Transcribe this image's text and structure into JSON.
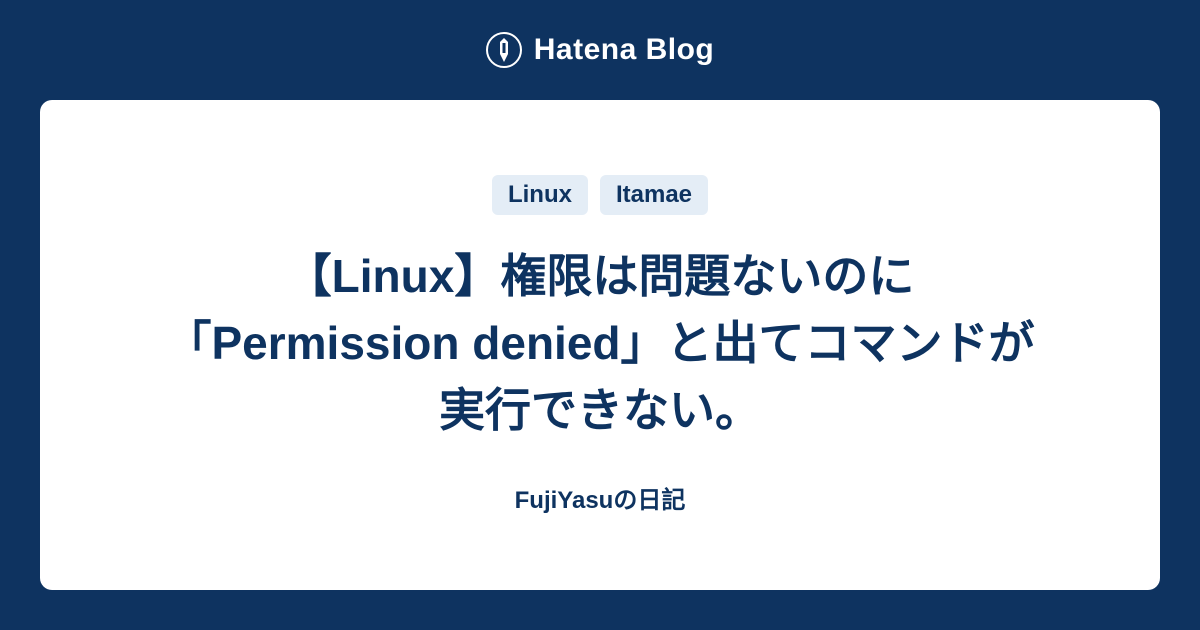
{
  "header": {
    "brand": "Hatena Blog"
  },
  "card": {
    "tags": [
      "Linux",
      "Itamae"
    ],
    "title": "【Linux】権限は問題ないのに「Permission denied」と出てコマンドが実行できない。",
    "author": "FujiYasuの日記"
  }
}
